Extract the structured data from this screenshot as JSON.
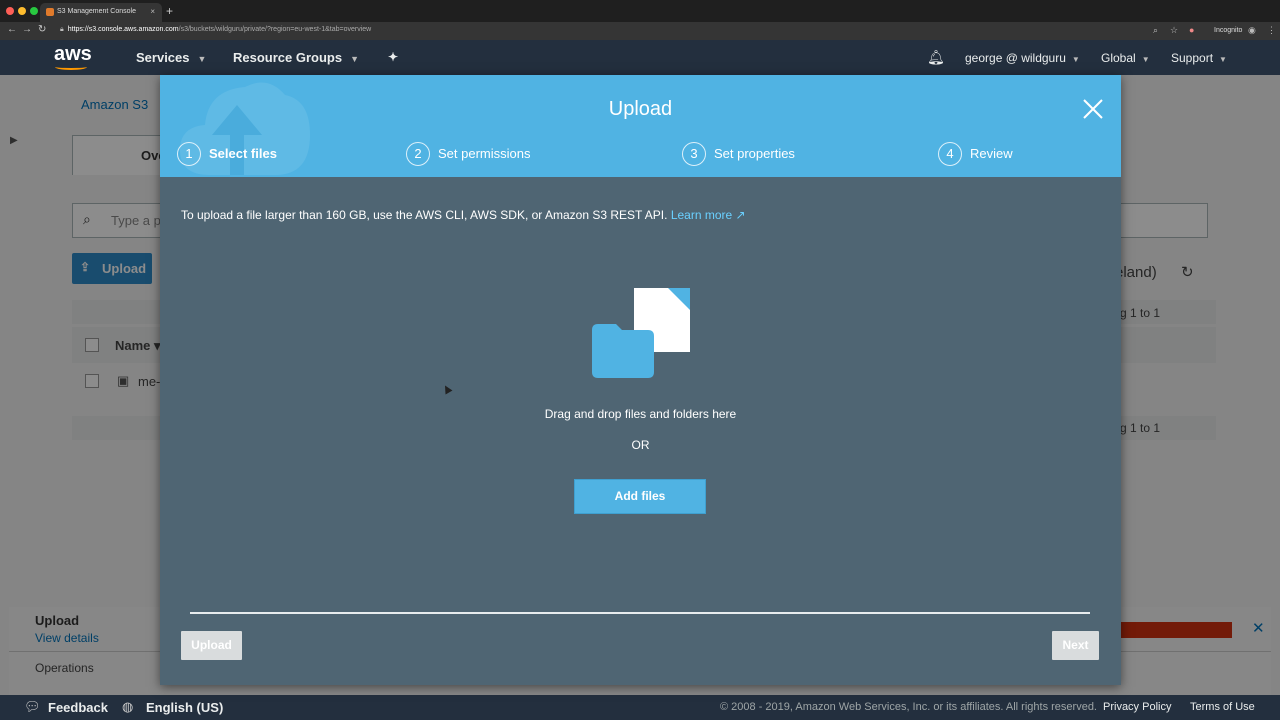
{
  "browser": {
    "tab_title": "S3 Management Console",
    "tab_close": "×",
    "new_tab": "+",
    "url_domain": "https://s3.console.aws.amazon.com",
    "url_path": "/s3/buckets/wildguru/private/?region=eu-west-1&tab=overview",
    "incognito_label": "Incognito"
  },
  "aws_nav": {
    "logo": "aws",
    "services": "Services",
    "resource_groups": "Resource Groups",
    "user": "george @ wildguru",
    "region": "Global",
    "support": "Support"
  },
  "background_page": {
    "breadcrumb": "Amazon S3",
    "tab_overview": "Ove",
    "search_placeholder": "Type a pr",
    "upload_button": "Upload",
    "region_partial": "eland)",
    "paging_top": "g 1 to 1",
    "paging_bottom": "g 1 to 1",
    "name_column": "Name",
    "row_name": "me-",
    "ops_title": "Upload",
    "ops_view_details": "View details",
    "ops_operations": "Operations"
  },
  "modal": {
    "title": "Upload",
    "steps": [
      {
        "num": "1",
        "label": "Select files"
      },
      {
        "num": "2",
        "label": "Set permissions"
      },
      {
        "num": "3",
        "label": "Set properties"
      },
      {
        "num": "4",
        "label": "Review"
      }
    ],
    "info_text": "To upload a file larger than 160 GB, use the AWS CLI, AWS SDK, or Amazon S3 REST API.",
    "learn_more": "Learn more",
    "drag_text": "Drag and drop files and folders here",
    "or_text": "OR",
    "add_files": "Add files",
    "upload_button": "Upload",
    "next_button": "Next"
  },
  "footer": {
    "feedback": "Feedback",
    "language": "English (US)",
    "copyright": "© 2008 - 2019, Amazon Web Services, Inc. or its affiliates. All rights reserved.",
    "privacy": "Privacy Policy",
    "terms": "Terms of Use"
  },
  "colors": {
    "modal_header": "#50b3e3",
    "modal_body": "#4f6573",
    "aws_nav": "#232f3e",
    "link": "#6ad0ff"
  }
}
